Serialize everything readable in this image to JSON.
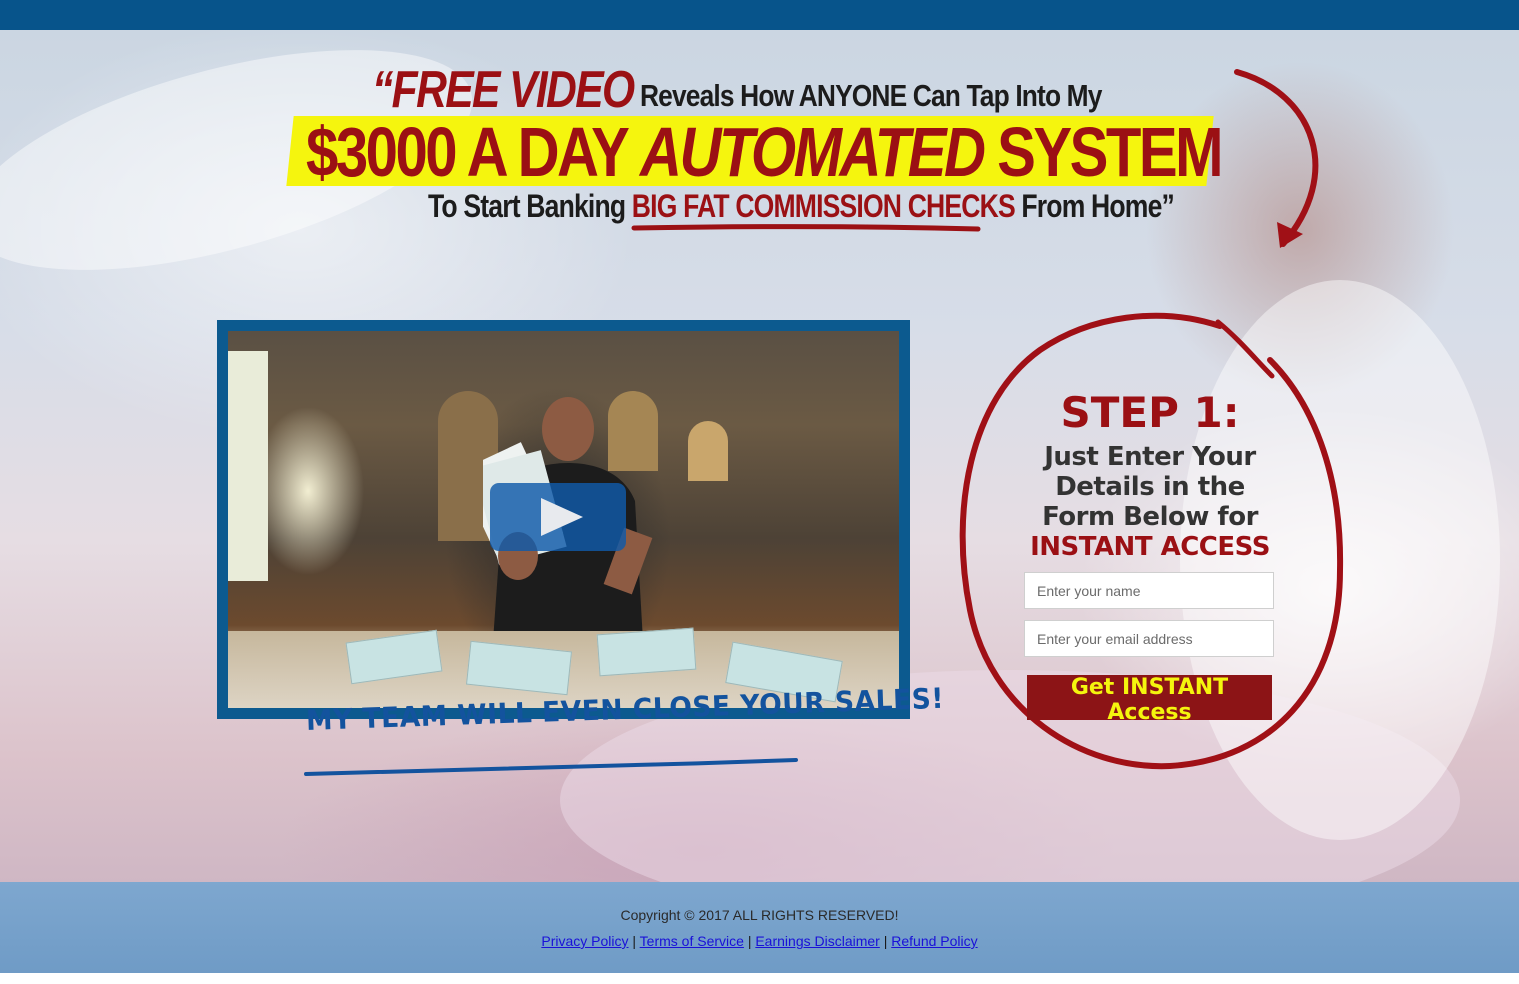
{
  "headline": {
    "free_video": "“FREE VIDEO",
    "line1_rest": "Reveals How ANYONE Can Tap Into My",
    "line2_a": "$3000 A DAY ",
    "line2_b": "AUTOMATED",
    "line2_c": " SYSTEM",
    "line3_a": "To Start Banking ",
    "line3_b": "BIG FAT COMMISSION CHECKS",
    "line3_c": " From Home”"
  },
  "video": {
    "play_icon": "play-icon"
  },
  "team_tagline": "MY TEAM WILL EVEN CLOSE YOUR SALES!",
  "optin": {
    "step_title": "STEP 1:",
    "desc_a": "Just Enter Your Details in the Form Below for ",
    "desc_b": "INSTANT ACCESS",
    "name_placeholder": "Enter your name",
    "email_placeholder": "Enter your email address",
    "submit_label": "Get INSTANT Access"
  },
  "footer": {
    "copyright": "Copyright © 2017 ALL RIGHTS RESERVED!",
    "links": [
      "Privacy Policy",
      "Terms of Service",
      "Earnings Disclaimer",
      "Refund Policy"
    ],
    "separator": "|"
  },
  "colors": {
    "brand_blue": "#07548b",
    "accent_red": "#9b1014",
    "highlight_yellow": "#f5f50e",
    "link_blue": "#1a11d8"
  }
}
